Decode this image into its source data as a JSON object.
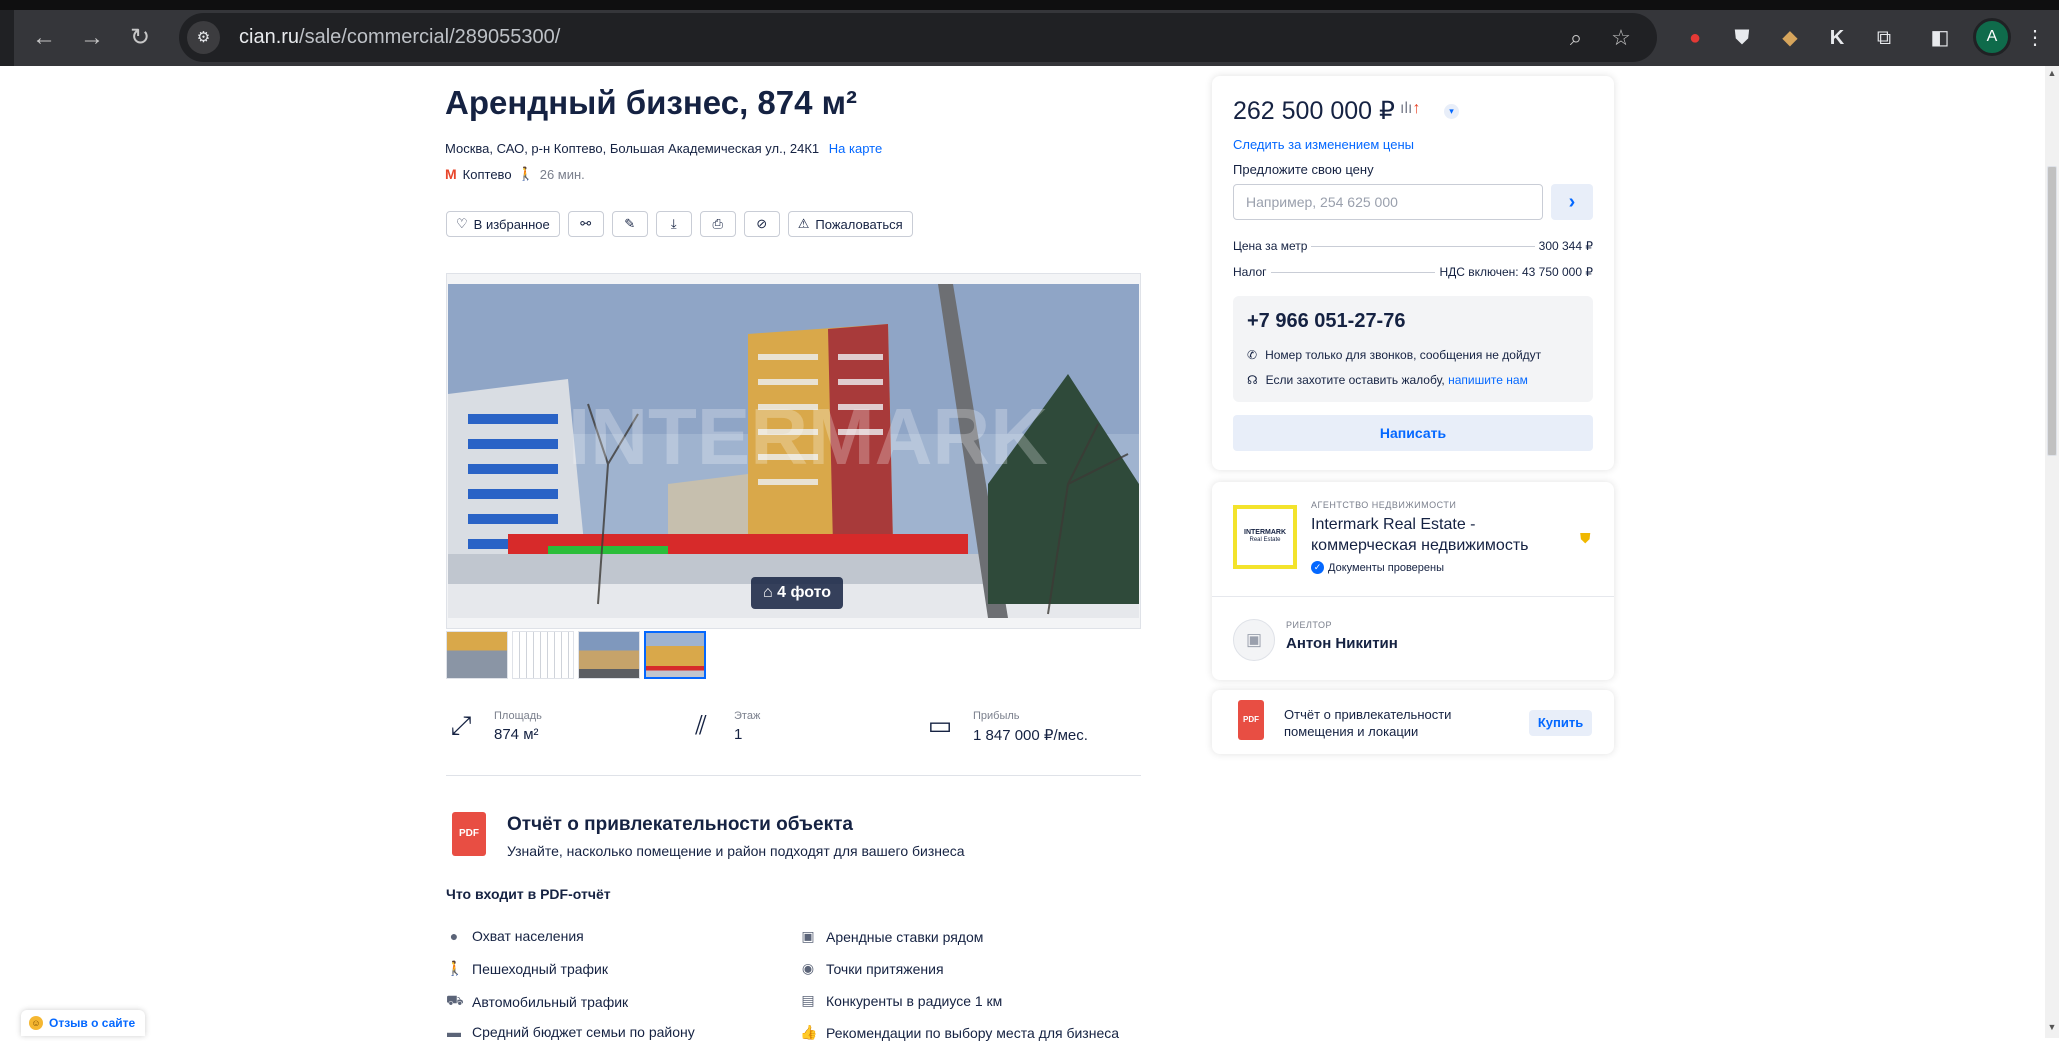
{
  "browser": {
    "url_host": "cian.ru",
    "url_path": "/sale/commercial/289055300/",
    "avatar_letter": "A"
  },
  "listing": {
    "title": "Арендный бизнес, 874 м²",
    "address": "Москва, САО, р-н Коптево, Большая Академическая ул., 24К1",
    "map_link": "На карте",
    "metro": "Коптево",
    "walk": "26 мин."
  },
  "actions": {
    "favorite": "В избранное",
    "complain": "Пожаловаться"
  },
  "gallery": {
    "photo_count": "4 фото",
    "watermark": "INTERMARK",
    "thumb_count": 4,
    "active_thumb": 4
  },
  "facts": [
    {
      "label": "Площадь",
      "value": "874 м²"
    },
    {
      "label": "Этаж",
      "value": "1"
    },
    {
      "label": "Прибыль",
      "value": "1 847 000 ₽/мес."
    }
  ],
  "report": {
    "icon": "PDF",
    "title": "Отчёт о привлекательности объекта",
    "subtitle": "Узнайте, насколько помещение и район подходят для вашего бизнеса",
    "includes_title": "Что входит в PDF-отчёт",
    "features_left": [
      "Охват населения",
      "Пешеходный трафик",
      "Автомобильный трафик",
      "Средний бюджет семьи по району"
    ],
    "features_right": [
      "Арендные ставки рядом",
      "Точки притяжения",
      "Конкуренты в радиусе 1 км",
      "Рекомендации по выбору места для бизнеса"
    ]
  },
  "price_card": {
    "price": "262 500 000 ₽",
    "follow": "Следить за изменением цены",
    "offer_label": "Предложите свою цену",
    "offer_placeholder": "Например, 254 625 000",
    "per_meter_label": "Цена за метр",
    "per_meter_value": "300 344 ₽",
    "tax_label": "Налог",
    "tax_value": "НДС включен: 43 750 000 ₽",
    "phone": "+7 966 051-27-76",
    "phone_note": "Номер только для звонков, сообщения не дойдут",
    "complaint_note": "Если захотите оставить жалобу,",
    "complaint_link": "напишите нам",
    "write_button": "Написать"
  },
  "agency": {
    "logo_text": "INTERMARK",
    "logo_sub": "Real Estate",
    "type": "АГЕНТСТВО НЕДВИЖИМОСТИ",
    "name": "Intermark Real Estate - коммерческая недвижимость",
    "verified": "Документы проверены",
    "realtor_type": "РИЕЛТОР",
    "realtor_name": "Антон Никитин"
  },
  "report_card": {
    "text": "Отчёт о привлекательности помещения и локации",
    "buy": "Купить"
  },
  "feedback": "Отзыв о сайте",
  "colors": {
    "accent": "#0468ff",
    "text": "#152242",
    "pdf": "#e84e43",
    "metro": "#e8462b"
  }
}
